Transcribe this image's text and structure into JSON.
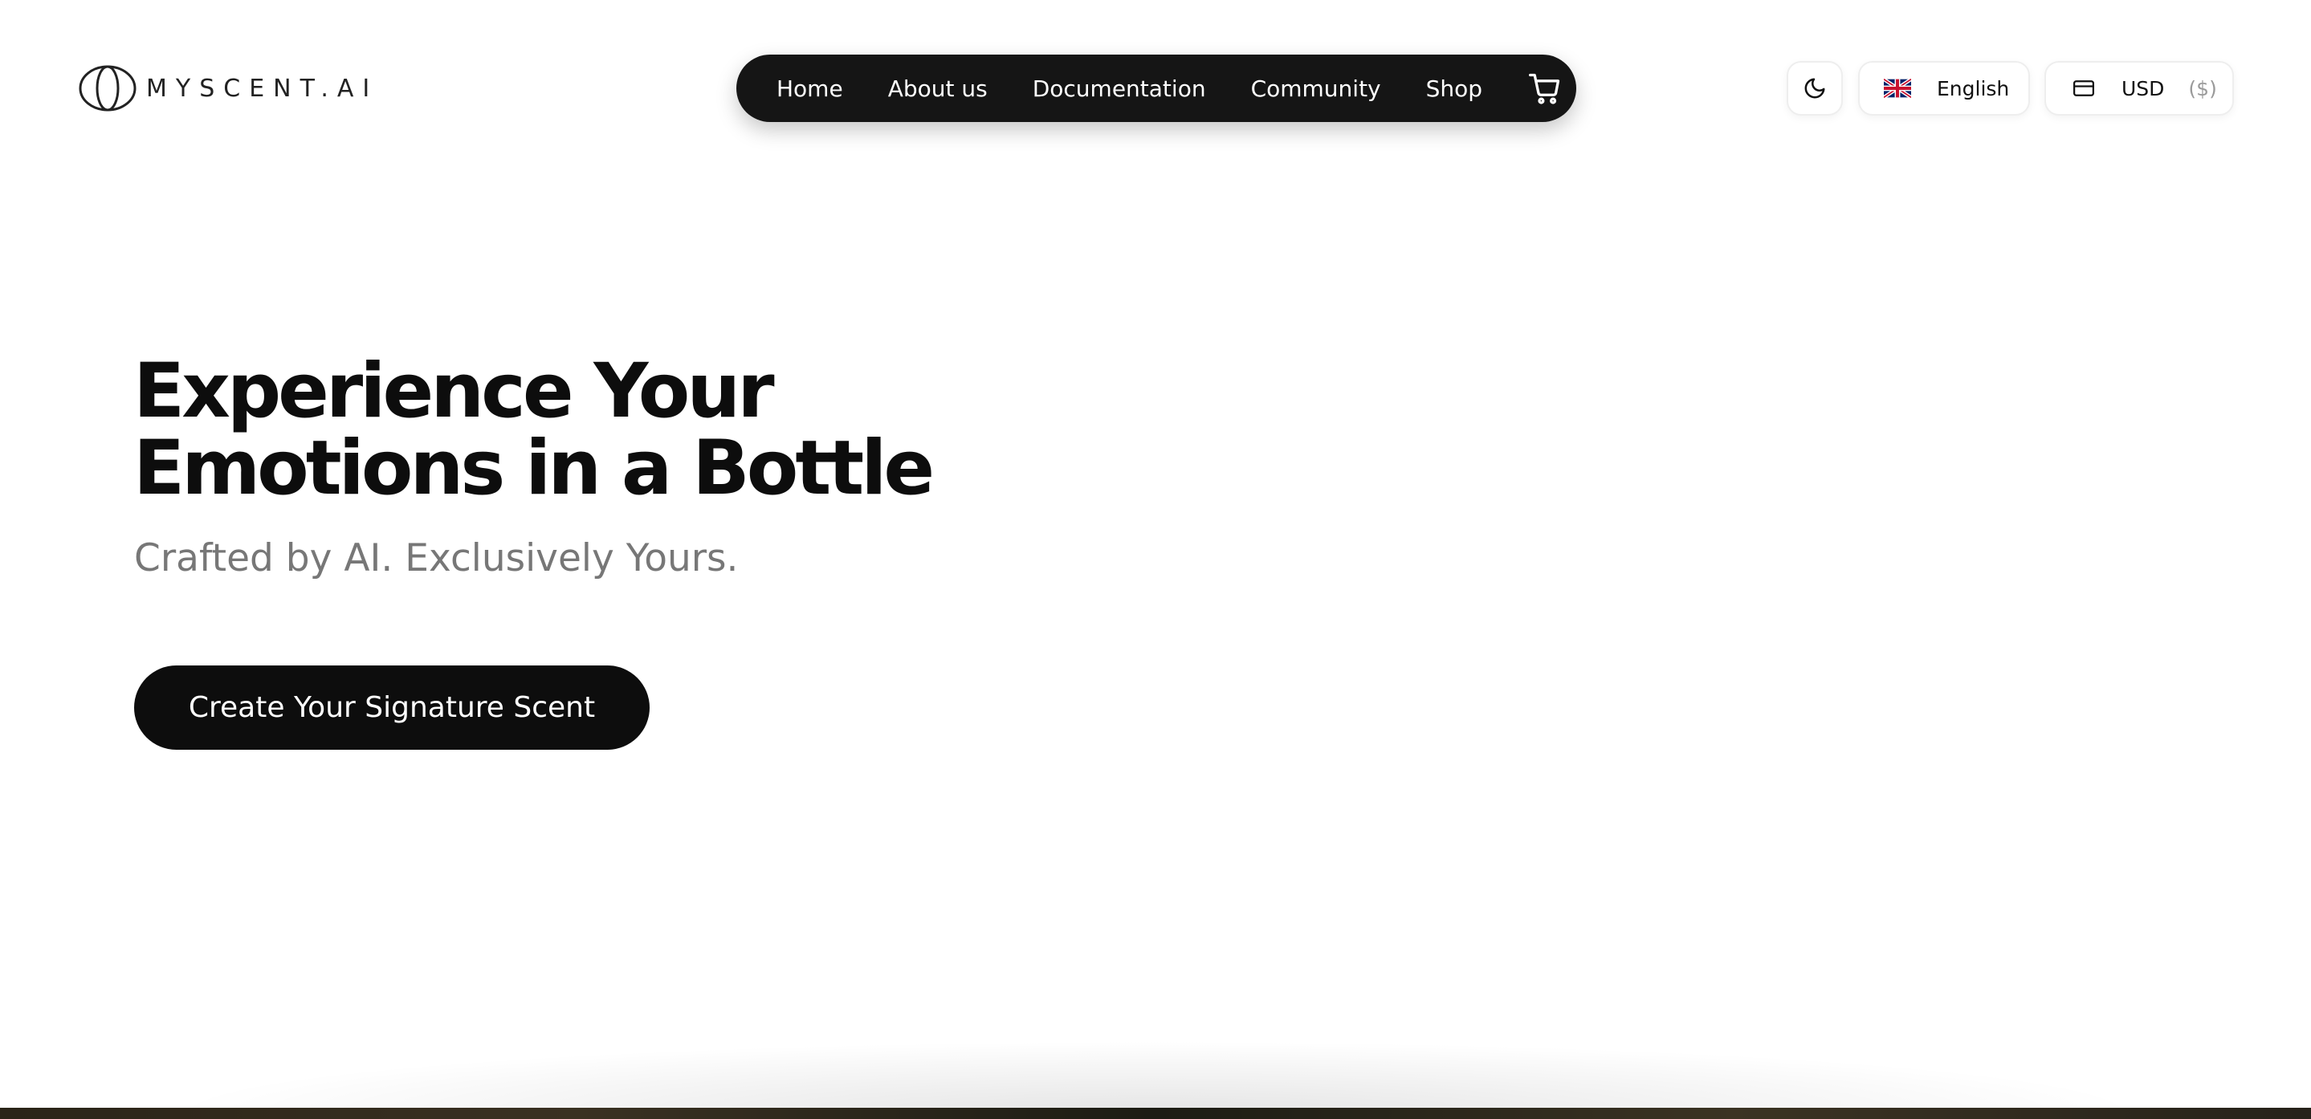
{
  "brand": {
    "logo_text": "MYSCENT.AI"
  },
  "nav": {
    "items": [
      {
        "label": "Home"
      },
      {
        "label": "About us"
      },
      {
        "label": "Documentation"
      },
      {
        "label": "Community"
      },
      {
        "label": "Shop"
      }
    ],
    "cart_icon": "shopping-cart-icon"
  },
  "controls": {
    "theme_icon": "moon-icon",
    "language": {
      "label": "English",
      "flag_icon": "uk-flag-icon"
    },
    "currency": {
      "label": "USD",
      "symbol": "($)",
      "icon": "credit-card-icon"
    }
  },
  "hero": {
    "title_line1": "Experience Your",
    "title_line2": "Emotions in a Bottle",
    "subtitle": "Crafted by AI. Exclusively Yours.",
    "cta_label": "Create Your Signature Scent"
  },
  "colors": {
    "nav_background": "#151515",
    "cta_background": "#0d0d0d",
    "subtitle": "#777777",
    "page_background": "#ffffff"
  }
}
